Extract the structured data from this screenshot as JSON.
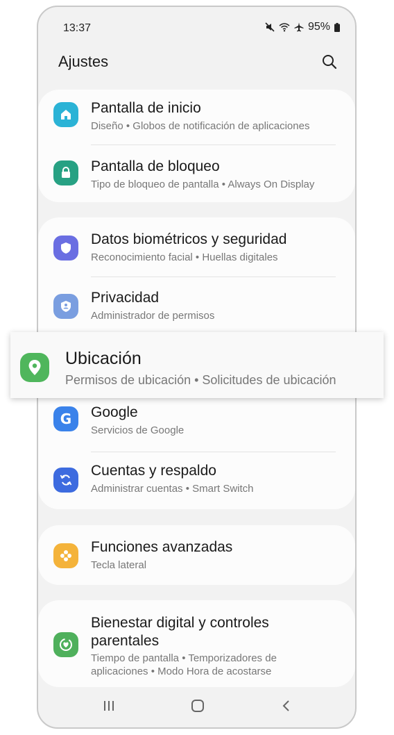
{
  "status": {
    "time": "13:37",
    "battery": "95%"
  },
  "header": {
    "title": "Ajustes"
  },
  "items": [
    {
      "label": "Pantalla de inicio",
      "sub": "Diseño  •  Globos de notificación de aplicaciones",
      "icon": "home-icon",
      "color": "#2bb3d6"
    },
    {
      "label": "Pantalla de bloqueo",
      "sub": "Tipo de bloqueo de pantalla  •  Always On Display",
      "icon": "lock-icon",
      "color": "#27a183"
    },
    {
      "label": "Datos biométricos y seguridad",
      "sub": "Reconocimiento facial  •  Huellas digitales",
      "icon": "shield-icon",
      "color": "#6a6ee2"
    },
    {
      "label": "Privacidad",
      "sub": "Administrador de permisos",
      "icon": "privacy-shield-icon",
      "color": "#7a9ee0"
    },
    {
      "label": "Google",
      "sub": "Servicios de Google",
      "icon": "google-icon",
      "color": "#3a82ea"
    },
    {
      "label": "Cuentas y respaldo",
      "sub": "Administrar cuentas  •  Smart Switch",
      "icon": "sync-icon",
      "color": "#3d6bdf"
    },
    {
      "label": "Funciones avanzadas",
      "sub": "Tecla lateral",
      "icon": "gear-plus-icon",
      "color": "#f4b33a"
    },
    {
      "label": "Bienestar digital y controles parentales",
      "sub": "Tiempo de pantalla  •  Temporizadores de aplicaciones  •  Modo Hora de acostarse",
      "icon": "wellbeing-icon",
      "color": "#4fb05c"
    }
  ],
  "highlight": {
    "label": "Ubicación",
    "sub": "Permisos de ubicación  •  Solicitudes de ubicación",
    "icon": "location-pin-icon",
    "color": "#4fb65c"
  }
}
